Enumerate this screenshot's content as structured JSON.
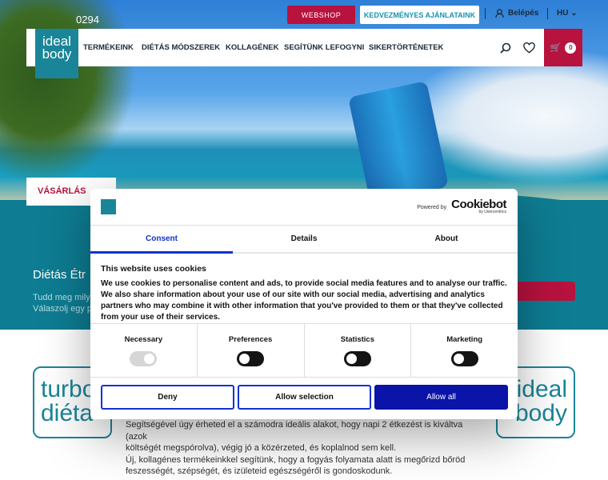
{
  "topbar": {
    "phone": "0294",
    "webshop": "WEBSHOP",
    "offers": "KEDVEZMÉNYES AJÁNLATAINK",
    "login": "Belépés",
    "language": "HU"
  },
  "nav": {
    "logo": "ideal body",
    "items": [
      "TERMÉKEINK",
      "DIÉTÁS MÓDSZEREK",
      "KOLLAGÉNEK",
      "SEGÍTÜNK LEFOGYNI",
      "SIKERTÖRTÉNETEK"
    ],
    "cart_count": "0"
  },
  "hero": {
    "tab": "VÁSÁRLÁS",
    "section_title": "Diétás Étr",
    "section_sub_1": "Tudd meg mily",
    "section_sub_2": "Válaszolj egy pá"
  },
  "brands": {
    "left": "turbo diéta",
    "right": "ideal body"
  },
  "body_lines": [
    "Segítségével úgy érheted el a számodra ideális alakot, hogy napi 2 étkezést is kiváltva (azok",
    "költségét megspórolva), végig jó a közérzeted, és koplalnod sem kell.",
    "Új, kollagénes termékeinkkel segítünk, hogy a fogyás folyamata alatt is megőrizd bőröd",
    "feszességét, szépségét, és izületeid egészségéről is gondoskodunk."
  ],
  "cookie": {
    "powered_by": "Powered by",
    "brand": "Cookiebot",
    "brand_sub": "by Usercentrics",
    "tabs": [
      "Consent",
      "Details",
      "About"
    ],
    "active_tab": "Consent",
    "title": "This website uses cookies",
    "text": "We use cookies to personalise content and ads, to provide social media features and to analyse our traffic. We also share information about your use of our site with our social media, advertising and analytics partners who may combine it with other information that you've provided to them or that they've collected from your use of their services.",
    "categories": [
      {
        "label": "Necessary",
        "enabled": true,
        "locked": true
      },
      {
        "label": "Preferences",
        "enabled": false
      },
      {
        "label": "Statistics",
        "enabled": false
      },
      {
        "label": "Marketing",
        "enabled": false
      }
    ],
    "buttons": {
      "deny": "Deny",
      "allow_selection": "Allow selection",
      "allow_all": "Allow all"
    }
  },
  "colors": {
    "brand_teal": "#0e7c92",
    "brand_red": "#b8123e",
    "cookiebot_blue": "#1032cf"
  }
}
